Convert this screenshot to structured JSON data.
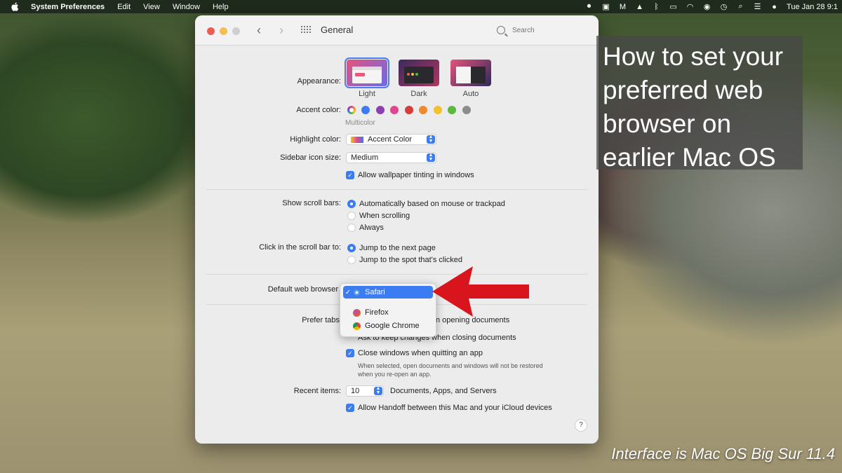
{
  "menubar": {
    "app": "System Preferences",
    "items": [
      "Edit",
      "View",
      "Window",
      "Help"
    ],
    "clock": "Tue Jan 28  9:1"
  },
  "window": {
    "title": "General",
    "search_placeholder": "Search"
  },
  "appearance": {
    "label": "Appearance:",
    "options": [
      "Light",
      "Dark",
      "Auto"
    ],
    "selected": "Light"
  },
  "accent": {
    "label": "Accent color:",
    "selected_caption": "Multicolor",
    "colors": [
      "#3b7cf3",
      "#8b3fb0",
      "#e0468a",
      "#d93a3a",
      "#ef8a2f",
      "#f2c12e",
      "#5cb83f",
      "#8c8c8c"
    ]
  },
  "highlight": {
    "label": "Highlight color:",
    "value": "Accent Color"
  },
  "sidebar_icon": {
    "label": "Sidebar icon size:",
    "value": "Medium"
  },
  "wallpaper_tint": {
    "label": "Allow wallpaper tinting in windows"
  },
  "scroll_bars": {
    "label": "Show scroll bars:",
    "options": [
      "Automatically based on mouse or trackpad",
      "When scrolling",
      "Always"
    ]
  },
  "click_scroll": {
    "label": "Click in the scroll bar to:",
    "options": [
      "Jump to the next page",
      "Jump to the spot that's clicked"
    ]
  },
  "default_browser": {
    "label": "Default web browser",
    "dropdown": [
      "Safari",
      "Firefox",
      "Google Chrome"
    ],
    "checkmark": "✓"
  },
  "prefer_tabs": {
    "label": "Prefer tabs",
    "partial_text": "n opening documents"
  },
  "ask_keep": {
    "label": "Ask to keep changes when closing documents"
  },
  "close_windows": {
    "label": "Close windows when quitting an app",
    "note_line1": "When selected, open documents and windows will not be restored",
    "note_line2": "when you re-open an app."
  },
  "recent_items": {
    "label": "Recent items:",
    "value": "10",
    "suffix": "Documents, Apps, and Servers"
  },
  "handoff": {
    "label": "Allow Handoff between this Mac and your iCloud devices"
  },
  "help": "?",
  "overlay": {
    "lines": [
      "How to set your",
      "preferred web",
      "browser on",
      "earlier Mac OS"
    ]
  },
  "caption": "Interface is Mac OS Big Sur 11.4"
}
